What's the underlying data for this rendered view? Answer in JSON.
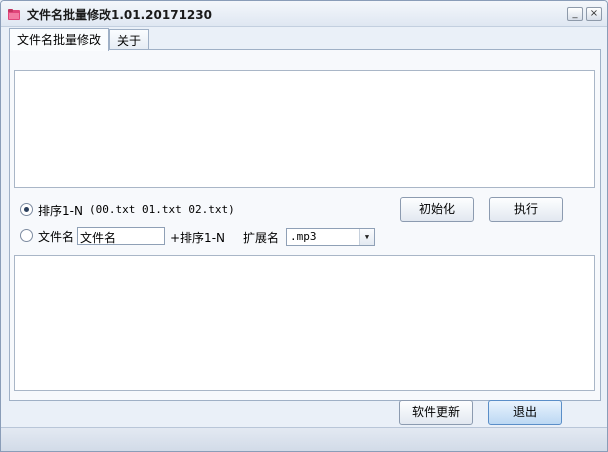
{
  "window": {
    "title": "文件名批量修改1.01.20171230",
    "minimize_glyph": "_",
    "close_glyph": "×",
    "icon": "folder-icon",
    "accent_icon_color": "#e0457a"
  },
  "tabs": [
    {
      "label": "文件名批量修改",
      "active": true
    },
    {
      "label": "关于",
      "active": false
    }
  ],
  "options": {
    "sequence": {
      "label": "排序1-N",
      "example": "(00.txt  01.txt 02.txt)",
      "selected": true
    },
    "filename": {
      "label": "文件名",
      "input_value": "文件名",
      "suffix": "+排序1-N",
      "selected": false
    },
    "extension": {
      "label": "扩展名",
      "selected_value": ".mp3"
    }
  },
  "buttons": {
    "init": "初始化",
    "execute": "执行",
    "update": "软件更新",
    "exit": "退出"
  }
}
